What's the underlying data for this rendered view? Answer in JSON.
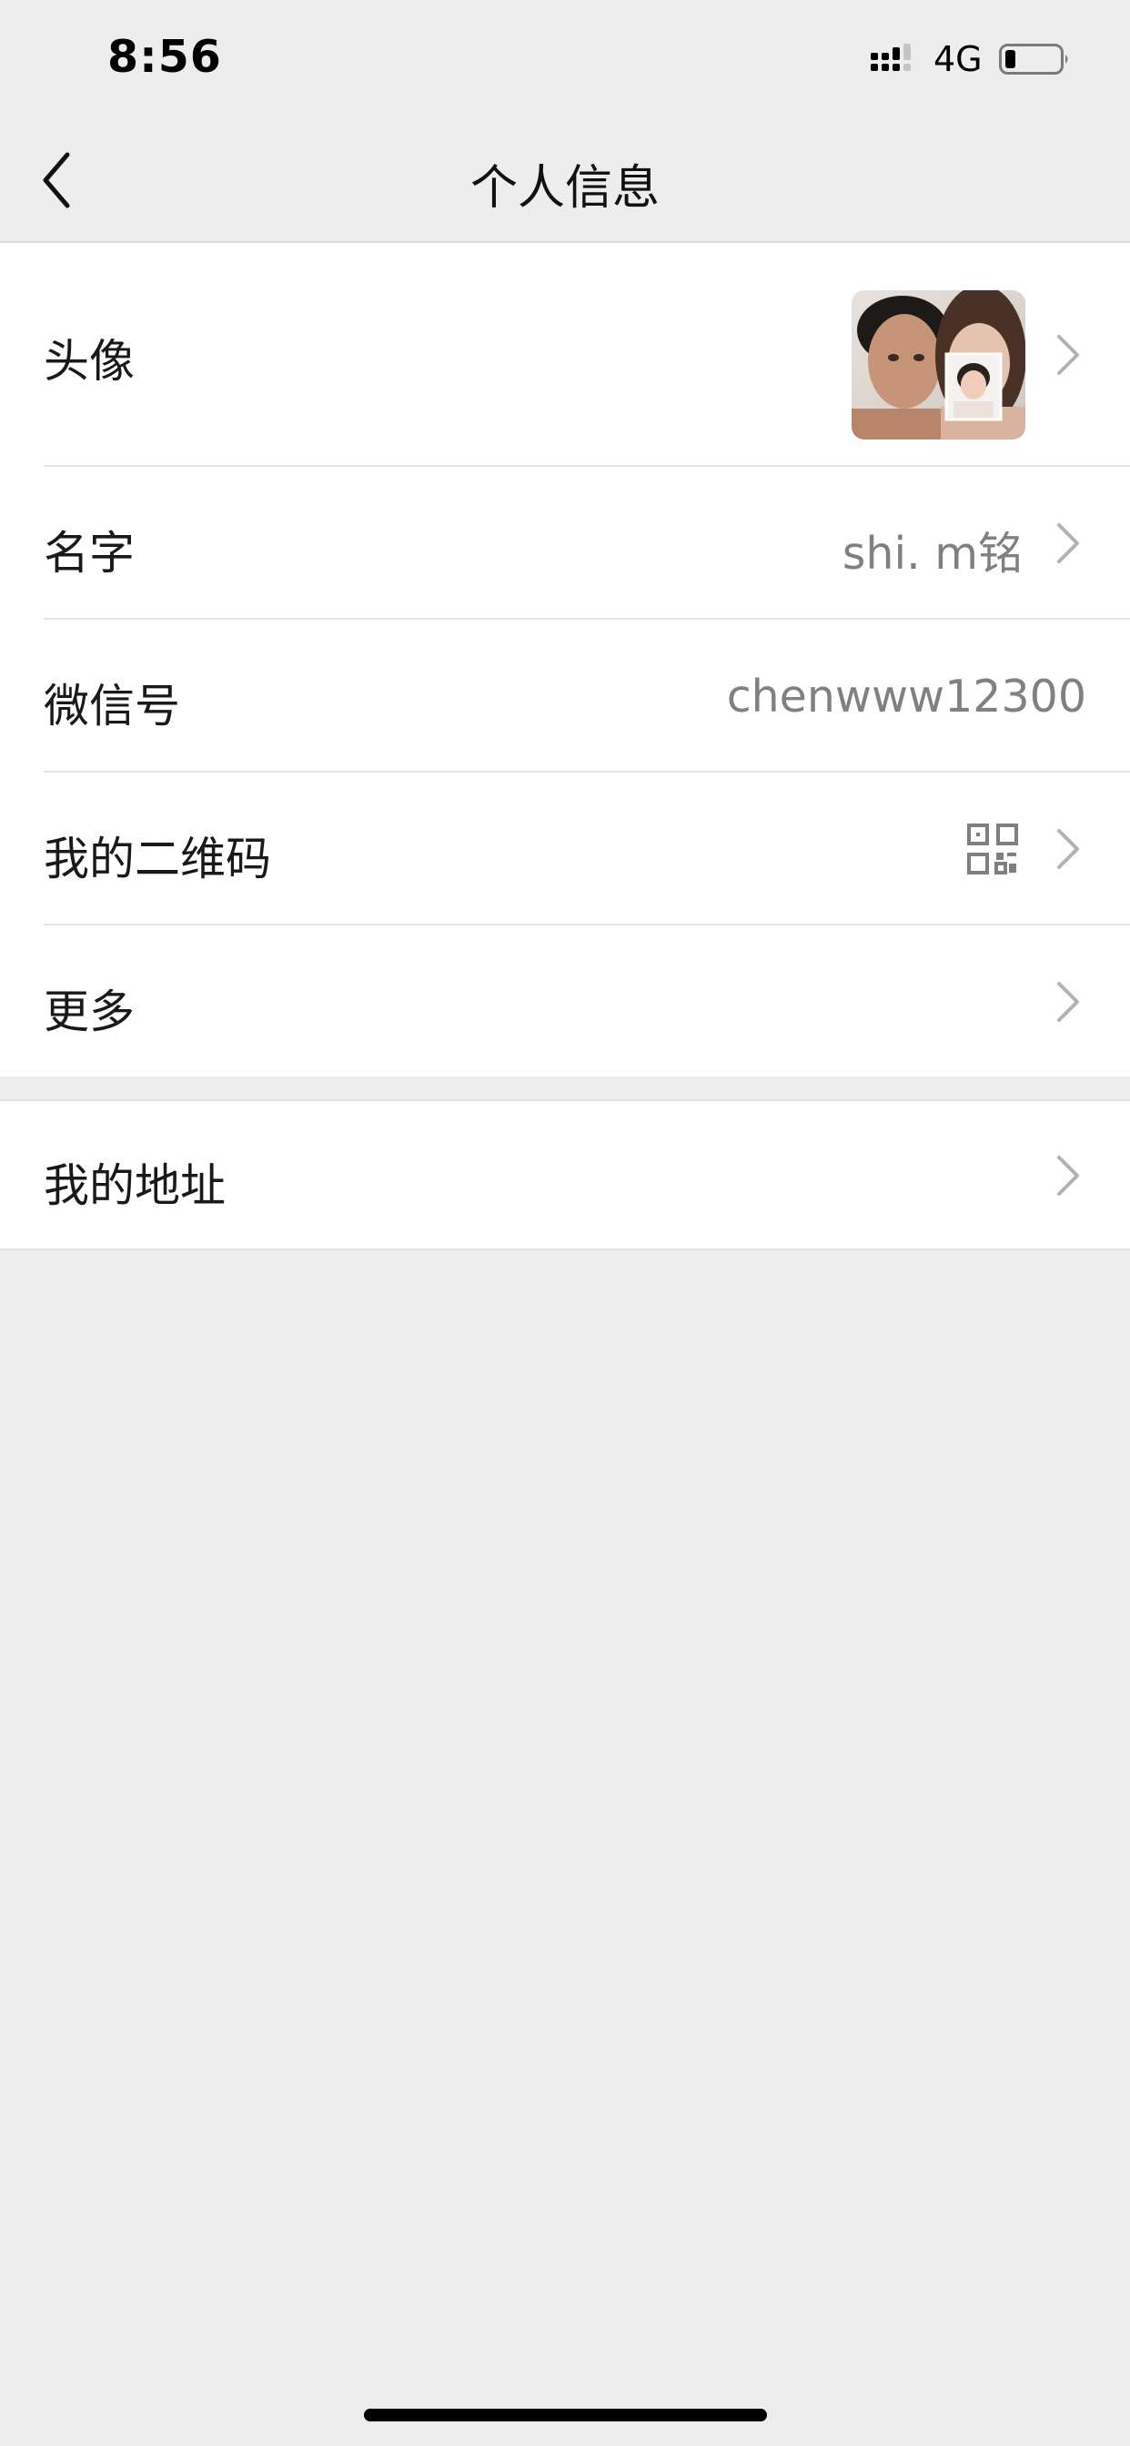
{
  "status_bar": {
    "time": "8:56",
    "network": "4G"
  },
  "nav": {
    "title": "个人信息"
  },
  "rows": [
    {
      "label": "头像"
    },
    {
      "label": "名字",
      "value": "shi. m铭"
    },
    {
      "label": "微信号",
      "value": "chenwww12300"
    },
    {
      "label": "我的二维码"
    },
    {
      "label": "更多"
    }
  ],
  "address": {
    "label": "我的地址"
  },
  "icons": [
    "back-chevron-icon",
    "signal-icon",
    "battery-icon",
    "qr-code-icon",
    "chevron-right-icon"
  ],
  "colors": {
    "background": "#ededed",
    "card": "#ffffff",
    "secondary_text": "#808080",
    "chevron": "#b2b2b2"
  }
}
